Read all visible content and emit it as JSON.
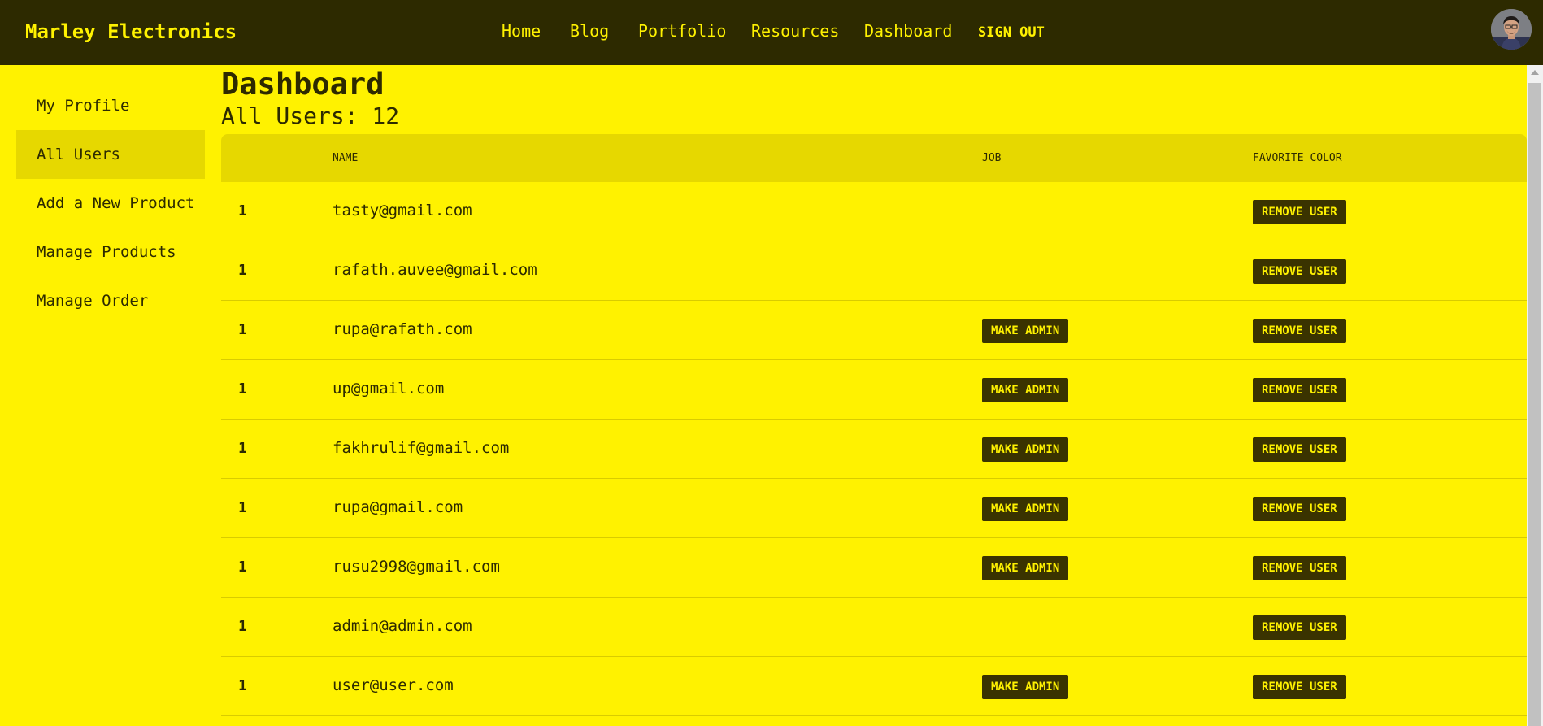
{
  "brand": "Marley Electronics",
  "nav": {
    "home": "Home",
    "blog": "Blog",
    "portfolio": "Portfolio",
    "resources": "Resources",
    "dashboard": "Dashboard",
    "signout": "SIGN OUT"
  },
  "avatar_icon": "user-avatar-photo",
  "sidebar": {
    "items": [
      {
        "label": "My Profile"
      },
      {
        "label": "All Users",
        "active": true
      },
      {
        "label": "Add a New Product"
      },
      {
        "label": "Manage Products"
      },
      {
        "label": "Manage Order"
      }
    ]
  },
  "main": {
    "title": "Dashboard",
    "user_count": "All Users: 12"
  },
  "table": {
    "headers": [
      "Name",
      "Job",
      "Favorite Color"
    ],
    "make_admin_label": "Make Admin",
    "remove_user_label": "Remove User",
    "rows": [
      {
        "num": "1",
        "email": "tasty@gmail.com",
        "make_admin": false
      },
      {
        "num": "1",
        "email": "rafath.auvee@gmail.com",
        "make_admin": false
      },
      {
        "num": "1",
        "email": "rupa@rafath.com",
        "make_admin": true
      },
      {
        "num": "1",
        "email": "up@gmail.com",
        "make_admin": true
      },
      {
        "num": "1",
        "email": "fakhrulif@gmail.com",
        "make_admin": true
      },
      {
        "num": "1",
        "email": "rupa@gmail.com",
        "make_admin": true
      },
      {
        "num": "1",
        "email": "rusu2998@gmail.com",
        "make_admin": true
      },
      {
        "num": "1",
        "email": "admin@admin.com",
        "make_admin": false
      },
      {
        "num": "1",
        "email": "user@user.com",
        "make_admin": true
      }
    ]
  },
  "colors": {
    "page_bg": "#fff200",
    "nav_bg": "#2d2a00",
    "header_bg": "#e6d800",
    "button_bg": "#3a3300"
  }
}
